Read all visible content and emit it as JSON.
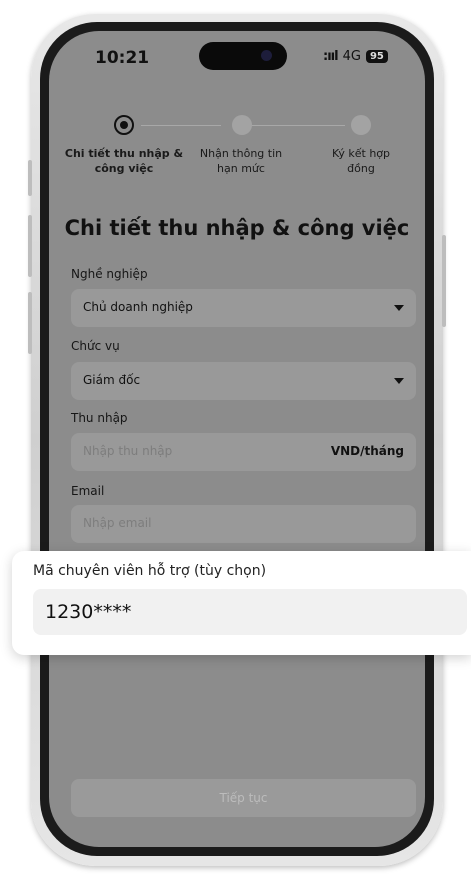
{
  "status_bar": {
    "time": "10:21",
    "signal": ":ııl",
    "network": "4G",
    "battery": "95"
  },
  "steps": [
    {
      "label": "Chi tiết thu nhập & công việc",
      "active": true
    },
    {
      "label": "Nhận thông tin hạn mức",
      "active": false
    },
    {
      "label": "Ký kết hợp đồng",
      "active": false
    }
  ],
  "form": {
    "title": "Chi tiết thu nhập & công việc",
    "occupation": {
      "label": "Nghề nghiệp",
      "value": "Chủ doanh nghiệp"
    },
    "position": {
      "label": "Chức vụ",
      "value": "Giám đốc"
    },
    "income": {
      "label": "Thu nhập",
      "placeholder": "Nhập thu nhập",
      "unit": "VND/tháng"
    },
    "email": {
      "label": "Email",
      "placeholder": "Nhập email"
    },
    "submit_label": "Tiếp tục"
  },
  "referral_card": {
    "label": "Mã chuyên viên hỗ trợ (tùy chọn)",
    "value": "1230****"
  },
  "colors": {
    "overlay": "#8c8c8c",
    "card_bg": "#ffffff",
    "input_bg": "#f1f1f1",
    "phone_frame": "#1b1b1b"
  }
}
